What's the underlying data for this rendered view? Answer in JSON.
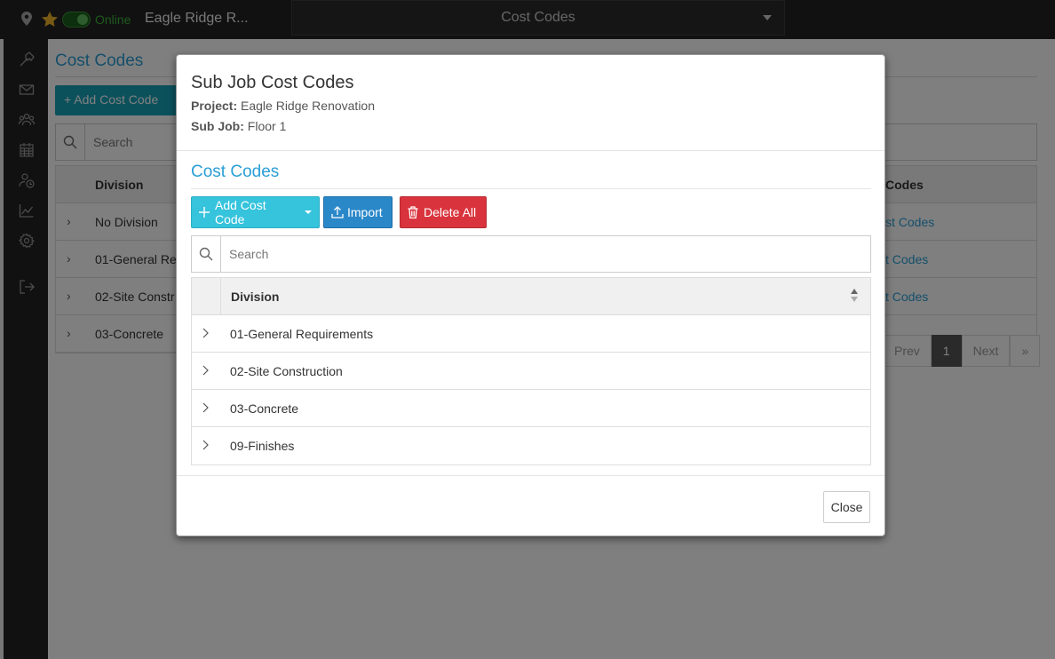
{
  "topbar": {
    "status": "Online",
    "project_name": "Eagle Ridge R...",
    "page_select": "Cost Codes"
  },
  "sidebar": {
    "icons": [
      "hammer-icon",
      "mail-icon",
      "users-icon",
      "calendar-icon",
      "user-clock-icon",
      "chart-icon",
      "gear-icon",
      "logout-icon"
    ]
  },
  "background": {
    "title": "Cost Codes",
    "add_button": "Add Cost Code",
    "search_placeholder": "Search",
    "columns": {
      "division": "Division",
      "codes": "Codes"
    },
    "rows": [
      {
        "name": "No Division",
        "link": "st Codes"
      },
      {
        "name": "01-General Re",
        "link": "t Codes"
      },
      {
        "name": "02-Site Constr",
        "link": "t Codes"
      },
      {
        "name": "03-Concrete",
        "link": ""
      }
    ],
    "pager": {
      "prev": "Prev",
      "page": "1",
      "next": "Next",
      "last": "»"
    }
  },
  "modal": {
    "title": "Sub Job Cost Codes",
    "project_label": "Project:",
    "project_value": "Eagle Ridge Renovation",
    "subjob_label": "Sub Job:",
    "subjob_value": "Floor 1",
    "section_title": "Cost Codes",
    "buttons": {
      "add": "Add Cost Code",
      "import": "Import",
      "delete_all": "Delete All",
      "close": "Close"
    },
    "search_placeholder": "Search",
    "table": {
      "column": "Division",
      "rows": [
        "01-General Requirements",
        "02-Site Construction",
        "03-Concrete",
        "09-Finishes"
      ]
    }
  },
  "colors": {
    "accent": "#2a9fd6",
    "add": "#36c3dc",
    "import": "#2a88c9",
    "delete": "#d9343d",
    "online": "#3cb43c"
  }
}
